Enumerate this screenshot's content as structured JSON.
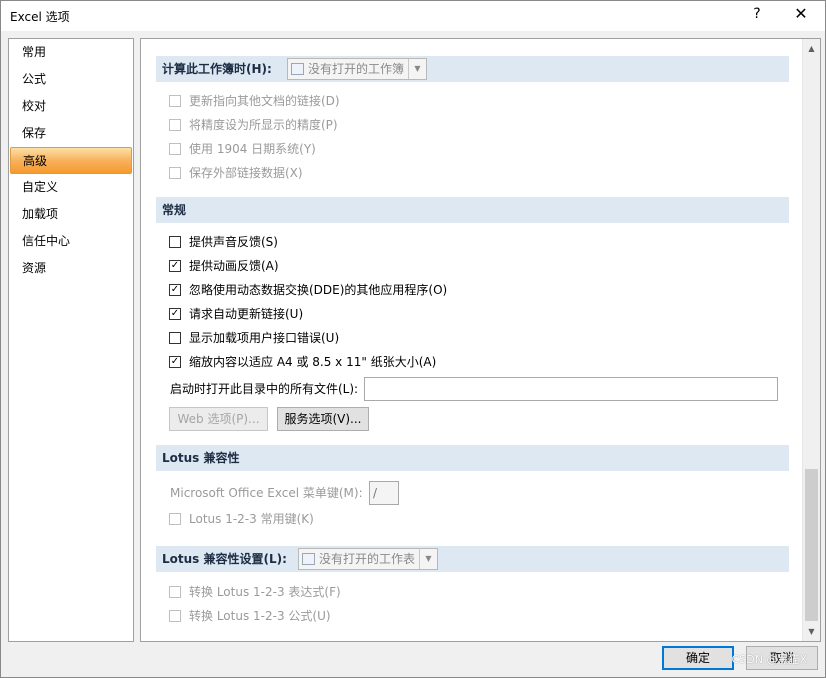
{
  "window": {
    "title": "Excel 选项",
    "help": "?",
    "close": "✕"
  },
  "nav": {
    "items": [
      {
        "label": "常用"
      },
      {
        "label": "公式"
      },
      {
        "label": "校对"
      },
      {
        "label": "保存"
      },
      {
        "label": "高级",
        "active": true
      },
      {
        "label": "自定义"
      },
      {
        "label": "加载项"
      },
      {
        "label": "信任中心"
      },
      {
        "label": "资源"
      }
    ]
  },
  "calc_section": {
    "header": "计算此工作簿时(H):",
    "combo_value": "没有打开的工作簿",
    "options": [
      {
        "label": "更新指向其他文档的链接(D)",
        "checked": false,
        "enabled": false
      },
      {
        "label": "将精度设为所显示的精度(P)",
        "checked": false,
        "enabled": false
      },
      {
        "label": "使用 1904 日期系统(Y)",
        "checked": false,
        "enabled": false
      },
      {
        "label": "保存外部链接数据(X)",
        "checked": false,
        "enabled": false
      }
    ]
  },
  "general_section": {
    "header": "常规",
    "options": [
      {
        "label": "提供声音反馈(S)",
        "checked": false,
        "enabled": true
      },
      {
        "label": "提供动画反馈(A)",
        "checked": true,
        "enabled": true
      },
      {
        "label": "忽略使用动态数据交换(DDE)的其他应用程序(O)",
        "checked": true,
        "enabled": true
      },
      {
        "label": "请求自动更新链接(U)",
        "checked": true,
        "enabled": true
      },
      {
        "label": "显示加载项用户接口错误(U)",
        "checked": false,
        "enabled": true
      },
      {
        "label": "缩放内容以适应 A4 或 8.5 x 11\" 纸张大小(A)",
        "checked": true,
        "enabled": true
      }
    ],
    "startup_label": "启动时打开此目录中的所有文件(L):",
    "startup_value": "",
    "web_options_button": "Web 选项(P)...",
    "service_options_button": "服务选项(V)..."
  },
  "lotus_section": {
    "header": "Lotus 兼容性",
    "menu_key_label": "Microsoft Office Excel 菜单键(M):",
    "menu_key_value": "/",
    "nav_keys_label": "Lotus 1-2-3 常用键(K)",
    "nav_keys_checked": false
  },
  "lotus_settings_section": {
    "header": "Lotus 兼容性设置(L):",
    "combo_value": "没有打开的工作表",
    "options": [
      {
        "label": "转换 Lotus 1-2-3 表达式(F)",
        "checked": false,
        "enabled": false
      },
      {
        "label": "转换 Lotus 1-2-3 公式(U)",
        "checked": false,
        "enabled": false
      }
    ]
  },
  "footer": {
    "ok": "确定",
    "cancel": "取消",
    "watermark": "CSDN @黑猫X"
  },
  "check_mark": "✓",
  "icons": {
    "scroll_up": "▲",
    "scroll_down": "▼",
    "combo_drop": "▼"
  }
}
